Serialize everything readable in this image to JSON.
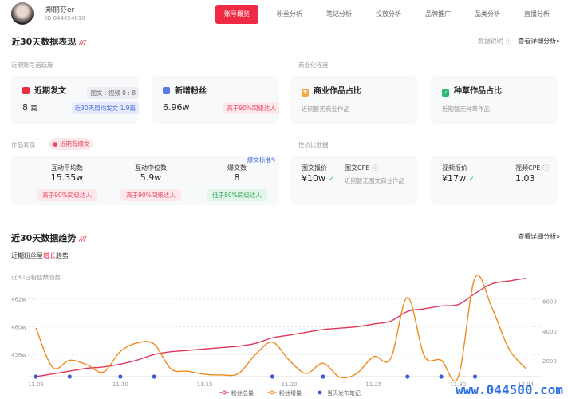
{
  "header": {
    "user_name": "郑丽芬er",
    "user_id": "ID 844654810",
    "tabs": [
      {
        "label": "账号概览",
        "active": true
      },
      {
        "label": "粉丝分析"
      },
      {
        "label": "笔记分析"
      },
      {
        "label": "投放分析"
      },
      {
        "label": "品牌推广"
      },
      {
        "label": "品类分析"
      },
      {
        "label": "直播分析"
      }
    ]
  },
  "perf": {
    "title": "近30天数据表现",
    "explain": "数据说明",
    "detail": "查看详细分析»",
    "activity_label": "近期账号活跃度",
    "posts": {
      "title": "近期发文",
      "ratio": "图文 : 视频 0 : 8",
      "value": "8",
      "unit": "篇",
      "tag": "近30天周均发文 1.9篇"
    },
    "fans": {
      "title": "新增粉丝",
      "value": "6.96w",
      "tag": "高于90%同级达人"
    },
    "commercial_label": "商业化程度",
    "biz": {
      "title": "商业作品占比",
      "note": "近期暂无商业作品"
    },
    "seed": {
      "title": "种草作品占比",
      "note": "近期暂无种草作品"
    },
    "works_label": "作品表现",
    "works_badge": "近期有爆文",
    "hit_standard": "爆文标准",
    "metrics": [
      {
        "label": "互动平均数",
        "value": "15.35w",
        "tag": "高于90%同级达人",
        "tone": "pink"
      },
      {
        "label": "互动中位数",
        "value": "5.9w",
        "tag": "高于90%同级达人",
        "tone": "pink"
      },
      {
        "label": "爆文数",
        "value": "8",
        "tag": "低于80%同级达人",
        "tone": "green"
      }
    ],
    "price_label": "性价比数据",
    "img_price": {
      "label": "图文报价",
      "value": "¥10w"
    },
    "img_cpe": {
      "label": "图文CPE",
      "note": "近期暂无图文商业作品"
    },
    "vid_price": {
      "label": "视频报价",
      "value": "¥17w"
    },
    "vid_cpe": {
      "label": "视频CPE",
      "value": "1.03"
    }
  },
  "trend": {
    "title": "近30天数据趋势",
    "detail": "查看详细分析»",
    "summary_pre": "近期粉丝呈",
    "summary_hl": "增长",
    "summary_post": "趋势",
    "chart_label": "近30日粉丝数趋势"
  },
  "chart_data": {
    "type": "line",
    "x": [
      "11.05",
      "11.06",
      "11.07",
      "11.08",
      "11.09",
      "11.10",
      "11.11",
      "11.12",
      "11.13",
      "11.14",
      "11.15",
      "11.16",
      "11.17",
      "11.18",
      "11.19",
      "11.20",
      "11.21",
      "11.22",
      "11.23",
      "11.24",
      "11.25",
      "11.26",
      "11.27",
      "11.28",
      "11.29",
      "11.30",
      "12.01",
      "12.02",
      "12.03",
      "12.04"
    ],
    "x_ticks": [
      "11.05",
      "11.10",
      "11.15",
      "11.20",
      "11.25",
      "11.30",
      "12.04"
    ],
    "y_left_ticks": [
      "458w",
      "460w",
      "462w"
    ],
    "y_left_vals": [
      458,
      460,
      462
    ],
    "y_left_range": [
      456.4,
      464
    ],
    "y_right_ticks": [
      "2000",
      "4000",
      "6000"
    ],
    "y_right_vals": [
      2000,
      4000,
      6000
    ],
    "y_right_range": [
      940,
      8000
    ],
    "series": [
      {
        "name": "粉丝总量",
        "axis": "left",
        "color": "#e0365a",
        "values": [
          456.4,
          456.6,
          456.8,
          457.0,
          457.1,
          457.3,
          457.6,
          458.0,
          458.2,
          458.3,
          458.4,
          458.5,
          458.6,
          458.8,
          459.2,
          459.4,
          459.6,
          459.8,
          459.9,
          460.0,
          460.2,
          460.4,
          461.1,
          461.3,
          461.5,
          461.6,
          462.4,
          463.1,
          463.3,
          463.5
        ]
      },
      {
        "name": "粉丝增量",
        "axis": "right",
        "color": "#f08a1c",
        "values": [
          4200,
          1550,
          2040,
          1750,
          1250,
          2630,
          3200,
          3120,
          1450,
          1300,
          1100,
          1050,
          1150,
          2430,
          3250,
          2040,
          1150,
          1840,
          900,
          1150,
          2280,
          2140,
          6250,
          2330,
          2040,
          900,
          7570,
          5570,
          2820,
          1490
        ]
      }
    ],
    "markers": {
      "name": "当天发布笔记",
      "color": "#3b5bdb",
      "dates": [
        "11.05",
        "11.07",
        "11.10",
        "11.12",
        "11.19",
        "11.22",
        "11.27",
        "11.29",
        "12.01"
      ]
    },
    "legend": "bottom",
    "grid": "dashed horizontal"
  },
  "watermark": "www.044500.com"
}
